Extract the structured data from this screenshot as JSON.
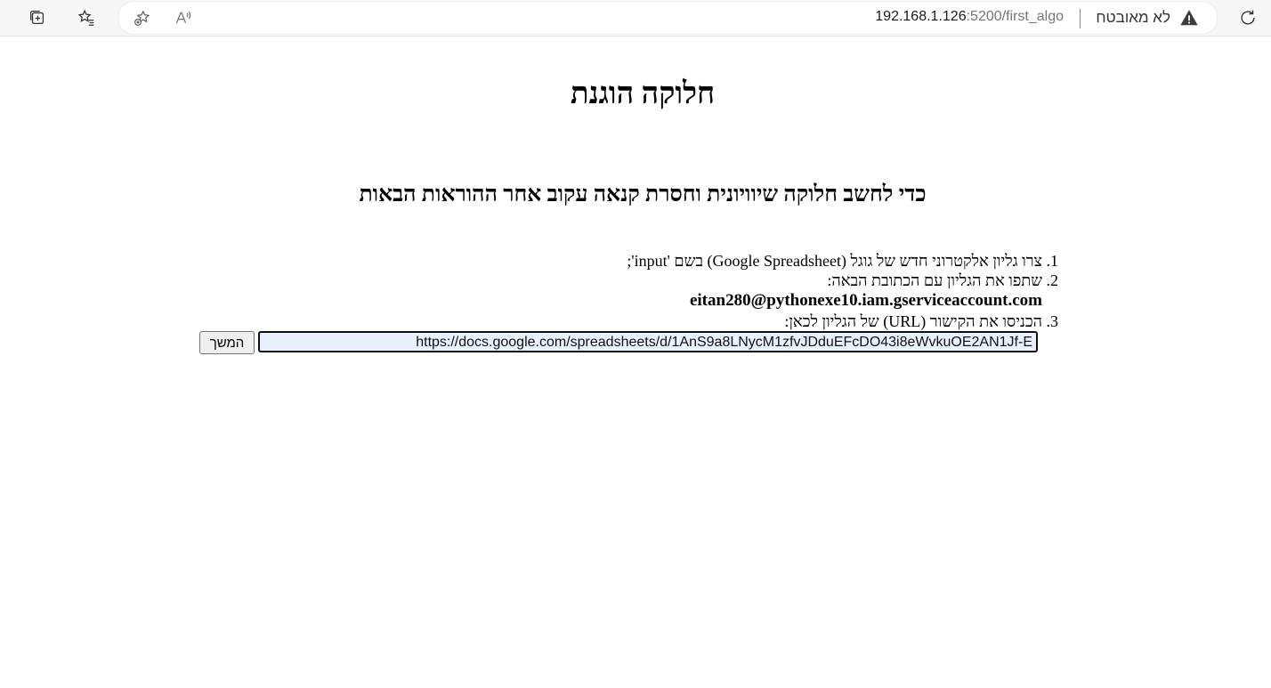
{
  "browser": {
    "url_host": "192.168.1.126",
    "url_path": ":5200/first_algo",
    "security_label": "לא מאובטח",
    "icons": [
      "collections-icon",
      "favorites-icon",
      "add-favorite-icon",
      "read-aloud-icon",
      "warning-icon",
      "refresh-icon"
    ]
  },
  "page": {
    "title": "חלוקה הוגנת",
    "subtitle": "כדי לחשב חלוקה שיוויונית וחסרת קנאה עקוב אחר ההוראות הבאות",
    "steps": [
      {
        "num": "1.",
        "text": "צרו גליון אלקטרוני חדש של גוגל (Google Spreadsheet) בשם 'input';"
      },
      {
        "num": "2.",
        "text": "שתפו את הגליון עם הכתובת הבאה:",
        "email": "eitan280@pythonexe10.iam.gserviceaccount.com"
      },
      {
        "num": "3.",
        "text": "הכניסו את הקישור (URL) של הגליון לכאן:"
      }
    ],
    "url_input_value": "https://docs.google.com/spreadsheets/d/1AnS9a8LNycM1zfvJDduEFcDO43i8eWvkuOE2AN1Jf-E",
    "continue_label": "המשך"
  }
}
